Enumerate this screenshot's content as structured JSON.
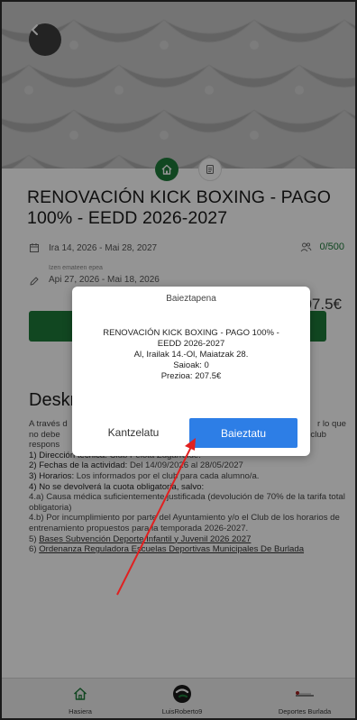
{
  "header": {
    "title": "RENOVACIÓN KICK BOXING - PAGO 100% - EEDD 2026-2027"
  },
  "details": {
    "dates": "Ira 14, 2026 - Mai 28, 2027",
    "count": "0/500",
    "registration_label": "Izen emateen epea",
    "registration_dates": "Api 27, 2026 - Mai 18, 2026",
    "price": "207.5€"
  },
  "description": {
    "heading": "Deskr",
    "line1_left": "A través d",
    "line1_right": "r lo que",
    "line2_left": "no debe",
    "line2_right": "club",
    "line3_left": "respons",
    "item1_label": "1) Dirección técnica:",
    "item1_value": " Club Pelota Zugarralde.",
    "item2_label": "2) Fechas de la actividad:",
    "item2_value": " Del 14/09/2026 al 28/05/2027",
    "item3_label": "3) Horarios:",
    "item3_value": " Los informados por el club para cada alumno/a.",
    "item4": "4) No se devolverá la cuota obligatoria, salvo:",
    "item4a": "4.a) Causa médica suficientemente justificada (devolución de 70% de la tarifa total obligatoria)",
    "item4b": "4.b) Por incumplimiento por parte del Ayuntamiento y/o el Club de los horarios de entrenamiento propuestos para la temporada 2026-2027.",
    "item5_prefix": "5) ",
    "item5_link": "Bases Subvención Deporte Infantil y Juvenil 2026 2027",
    "item6_prefix": "6) ",
    "item6_link": "Ordenanza Reguladora Escuelas Deportivas Municipales De Burlada"
  },
  "dialog": {
    "title": "Baieztapena",
    "line1": "RENOVACIÓN KICK BOXING - PAGO 100% -",
    "line2": "EEDD 2026-2027",
    "line3": "Al, Irailak 14.-Ol, Maiatzak 28.",
    "line4": "Saioak: 0",
    "line5": "Prezioa: 207.5€",
    "cancel_label": "Kantzelatu",
    "confirm_label": "Baieztatu"
  },
  "bottom_nav": {
    "items": [
      {
        "label": "Hasiera",
        "icon": "home-icon"
      },
      {
        "label": "LuisRoberto9",
        "icon": "user-logo-icon"
      },
      {
        "label": "Deportes Burlada",
        "icon": "club-logo-icon"
      }
    ]
  },
  "colors": {
    "accent_green": "#1e7a3a",
    "confirm_blue": "#2d7ee6",
    "annotation_red": "#e02020"
  }
}
